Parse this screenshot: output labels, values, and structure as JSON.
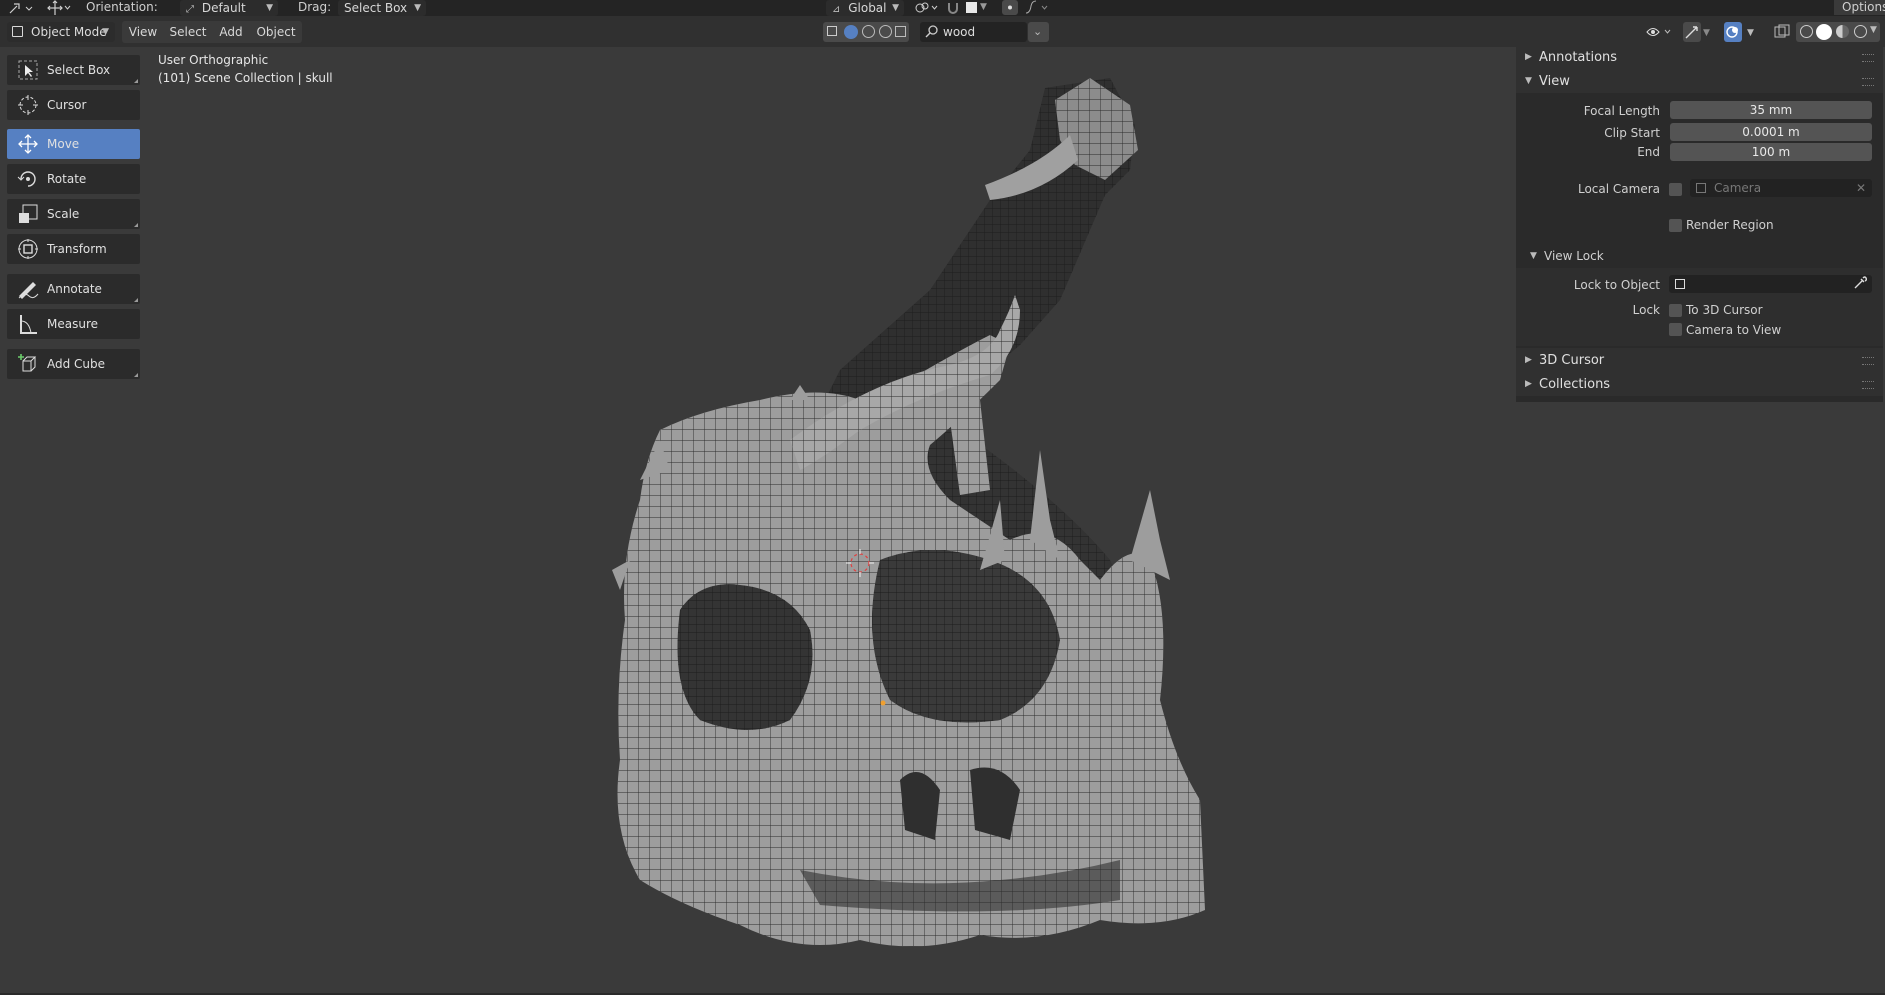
{
  "header": {
    "orientation_label": "Orientation:",
    "orientation_value": "Default",
    "drag_label": "Drag:",
    "drag_value": "Select Box",
    "transform_orientation": "Global",
    "options_label": "Options"
  },
  "viewport_header": {
    "mode": "Object Mode",
    "menus": [
      "View",
      "Select",
      "Add",
      "Object"
    ],
    "search_value": "wood"
  },
  "toolbar": {
    "tools": [
      {
        "label": "Select Box",
        "icon": "select-box-icon",
        "active": false
      },
      {
        "label": "Cursor",
        "icon": "cursor-icon",
        "active": false
      },
      {
        "label": "Move",
        "icon": "move-icon",
        "active": true
      },
      {
        "label": "Rotate",
        "icon": "rotate-icon",
        "active": false
      },
      {
        "label": "Scale",
        "icon": "scale-icon",
        "active": false
      },
      {
        "label": "Transform",
        "icon": "transform-icon",
        "active": false
      },
      {
        "label": "Annotate",
        "icon": "annotate-icon",
        "active": false
      },
      {
        "label": "Measure",
        "icon": "measure-icon",
        "active": false
      },
      {
        "label": "Add Cube",
        "icon": "add-cube-icon",
        "active": false
      }
    ]
  },
  "viewport": {
    "view_name": "User Orthographic",
    "collection_info": "(101) Scene Collection | skull"
  },
  "npanel": {
    "annotations_label": "Annotations",
    "view_label": "View",
    "focal_length_label": "Focal Length",
    "focal_length_value": "35 mm",
    "clip_start_label": "Clip Start",
    "clip_start_value": "0.0001 m",
    "end_label": "End",
    "end_value": "100 m",
    "local_camera_label": "Local Camera",
    "camera_placeholder": "Camera",
    "render_region_label": "Render Region",
    "view_lock_label": "View Lock",
    "lock_to_object_label": "Lock to Object",
    "lock_label": "Lock",
    "to_3d_cursor_label": "To 3D Cursor",
    "camera_to_view_label": "Camera to View",
    "cursor_3d_label": "3D Cursor",
    "collections_label": "Collections"
  },
  "colors": {
    "accent": "#5680c2",
    "viewport_bg": "#3a3a3a",
    "mesh_fill": "#9d9d9d"
  }
}
